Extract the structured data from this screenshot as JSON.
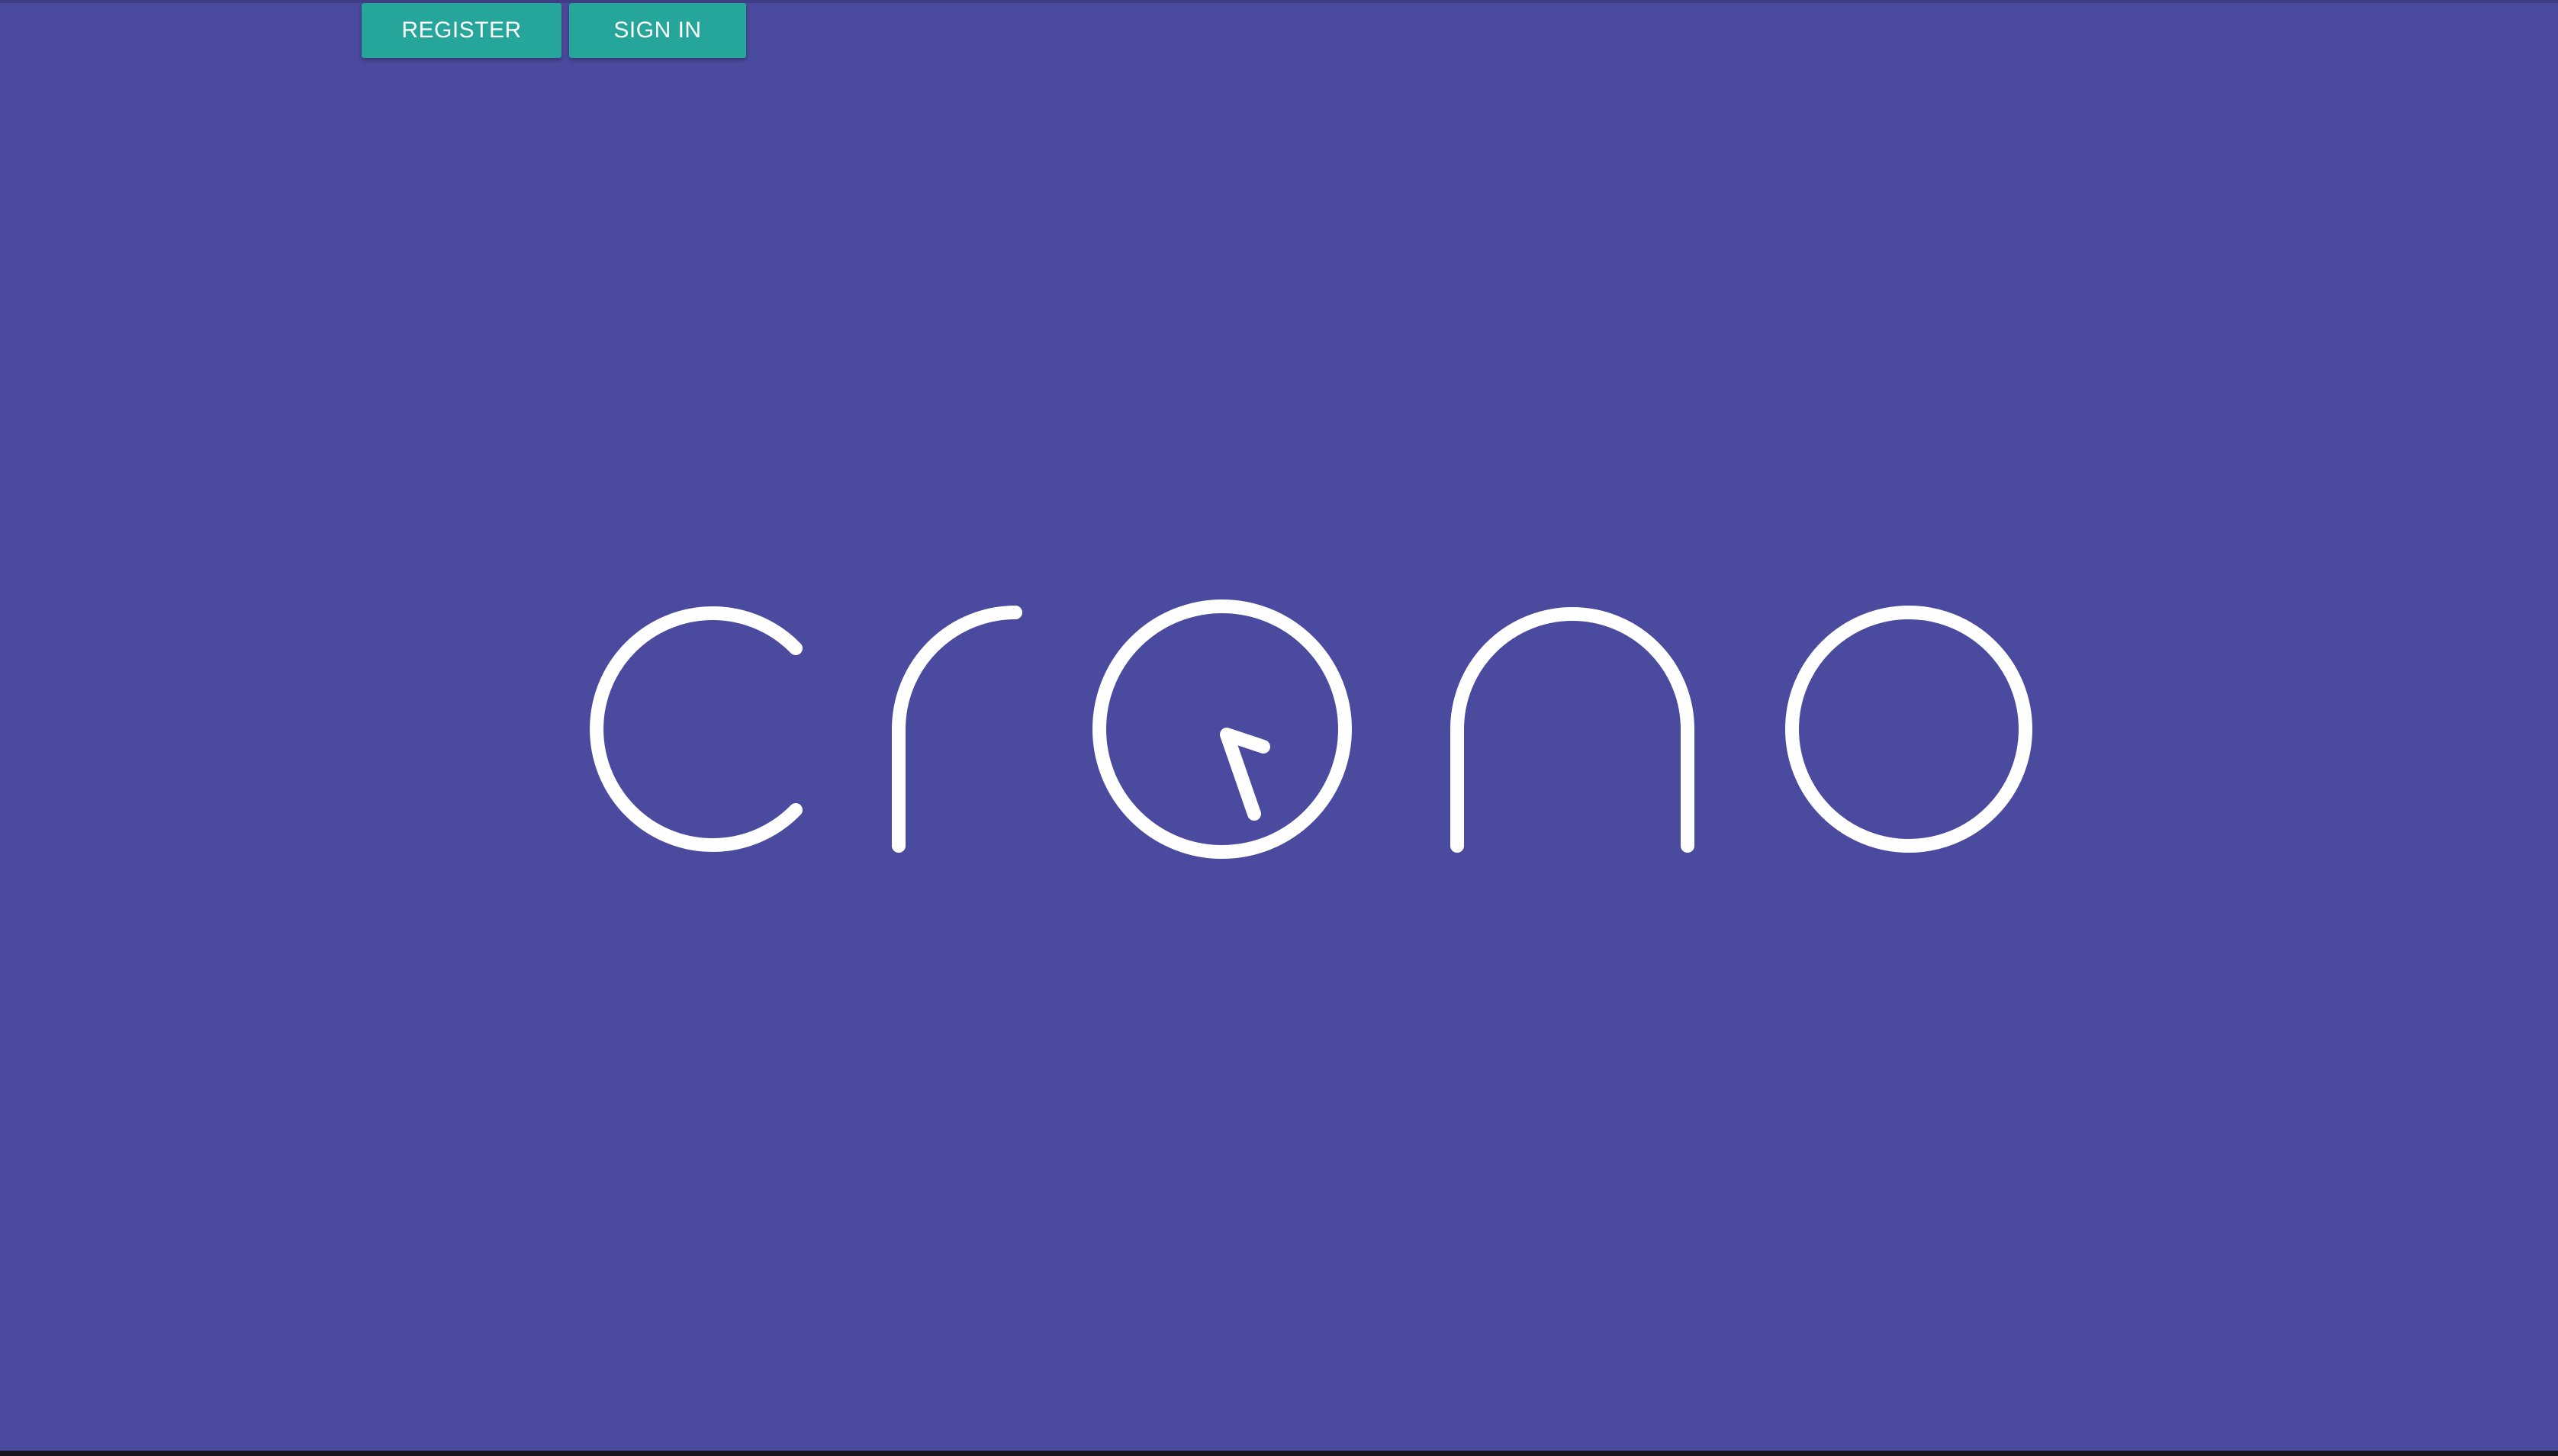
{
  "toolbar": {
    "register_label": "REGISTER",
    "signin_label": "SIGN IN"
  },
  "logo": {
    "text": "crono",
    "icon": "clock-icon"
  },
  "colors": {
    "background": "#4a4a9f",
    "button": "#26a69a",
    "button_text": "#ffffff",
    "logo_stroke": "#ffffff"
  }
}
